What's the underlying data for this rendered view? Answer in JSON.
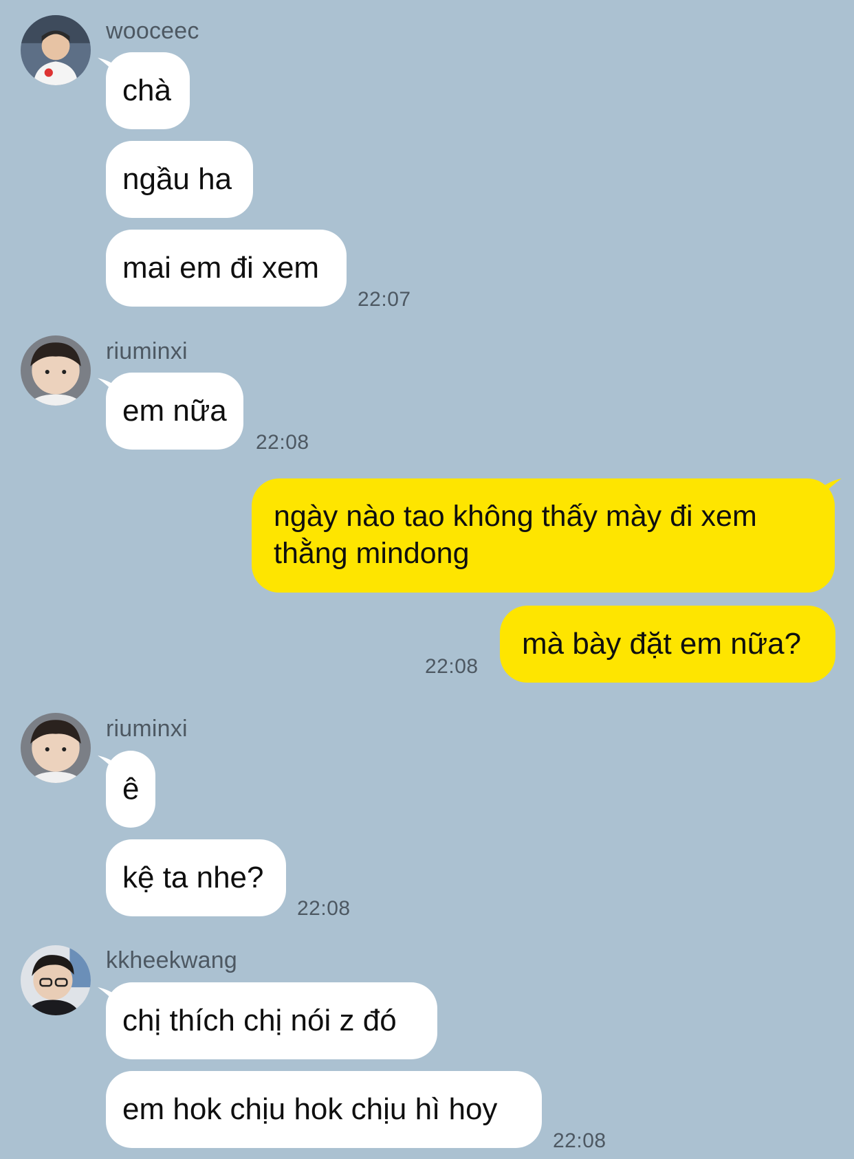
{
  "colors": {
    "background": "#abc1d1",
    "incoming_bubble": "#ffffff",
    "outgoing_bubble": "#fee500",
    "meta_text": "#4d5862"
  },
  "groups": [
    {
      "sender": "wooceec",
      "avatar_icon": "user-avatar-photo",
      "messages": [
        "chà",
        "ngầu ha",
        "mai em đi xem"
      ],
      "time": "22:07"
    },
    {
      "sender": "riuminxi",
      "avatar_icon": "user-avatar-photo",
      "messages": [
        "em nữa"
      ],
      "time": "22:08"
    },
    {
      "sender": "",
      "outgoing": true,
      "messages": [
        "ngày nào tao không thấy mày đi xem thằng mindong",
        "mà bày đặt em nữa?"
      ],
      "time": "22:08"
    },
    {
      "sender": "riuminxi",
      "avatar_icon": "user-avatar-photo",
      "messages": [
        "ê",
        "kệ ta nhe?"
      ],
      "time": "22:08"
    },
    {
      "sender": "kkheekwang",
      "avatar_icon": "user-avatar-photo",
      "messages": [
        "chị thích chị nói z đó",
        "em hok chịu hok chịu hì hoy"
      ],
      "time": "22:08"
    }
  ]
}
